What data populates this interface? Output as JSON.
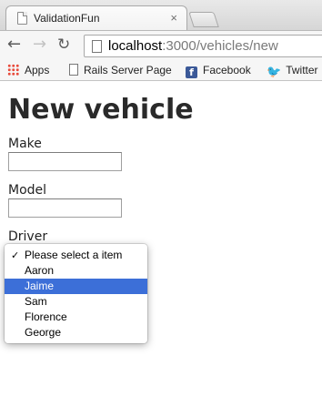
{
  "browser": {
    "tab_title": "ValidationFun",
    "tab_close": "×",
    "url_host": "localhost",
    "url_rest": ":3000/vehicles/new",
    "bookmarks": [
      "Apps",
      "Rails Server Page",
      "Facebook",
      "Twitter"
    ]
  },
  "page": {
    "heading": "New vehicle",
    "fields": {
      "make_label": "Make",
      "make_value": "",
      "model_label": "Model",
      "model_value": "",
      "driver_label": "Driver"
    }
  },
  "driver_select": {
    "checked_option": "Please select a item",
    "highlighted_option": "Jaime",
    "options": [
      "Please select a item",
      "Aaron",
      "Jaime",
      "Sam",
      "Florence",
      "George"
    ]
  }
}
